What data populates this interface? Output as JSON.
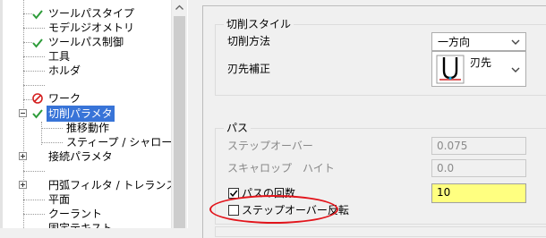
{
  "tree": {
    "items": [
      {
        "label": "ツールパスタイプ"
      },
      {
        "label": "モデルジオメトリ"
      },
      {
        "label": "ツールパス制御"
      },
      {
        "label": "工具"
      },
      {
        "label": "ホルダ"
      },
      {
        "label": "ワーク"
      },
      {
        "label": "切削パラメタ"
      },
      {
        "label": "推移動作"
      },
      {
        "label": "スティープ / シャロー"
      },
      {
        "label": "接続パラメタ"
      },
      {
        "label": "円弧フィルタ / トレランス"
      },
      {
        "label": "平面"
      },
      {
        "label": "クーラント"
      },
      {
        "label": "固定テキスト"
      }
    ]
  },
  "panel": {
    "cut_style": {
      "title": "切削スタイル",
      "method_label": "切削方法",
      "method_value": "一方向",
      "comp_label": "刃先補正",
      "comp_value": "刃先"
    },
    "path": {
      "title": "パス",
      "stepover_label": "ステップオーバー",
      "stepover_value": "0.075",
      "scallop_label": "スキャロップ　ハイト",
      "scallop_value": "0.0",
      "passes_label": "パスの回数",
      "passes_value": "10",
      "reverse_label": "ステップオーバー反転"
    }
  },
  "colors": {
    "selection": "#3874d8",
    "highlight_field": "#ffff80",
    "annotation": "#e2141b",
    "check": "#2e9c3a",
    "prohibit": "#d42020"
  }
}
